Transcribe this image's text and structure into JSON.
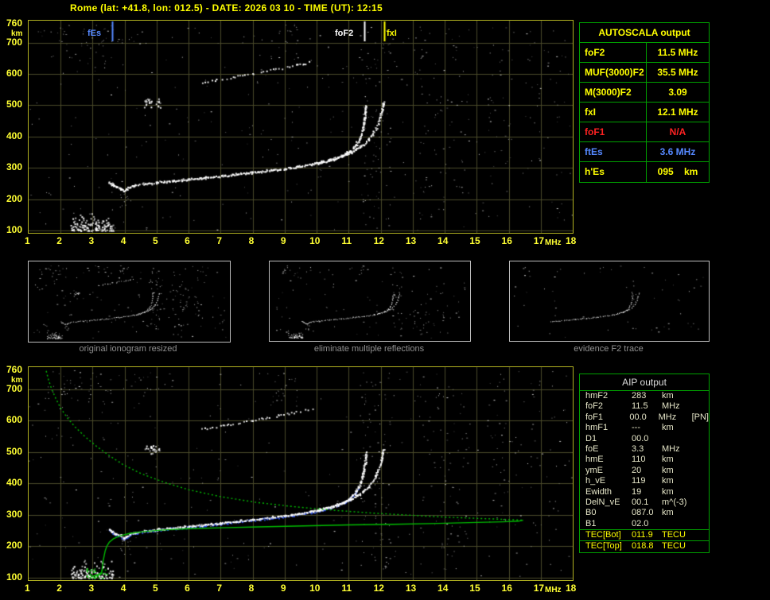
{
  "title": "Rome (lat: +41.8, lon: 012.5) - DATE: 2026 03 10 - TIME (UT): 12:15",
  "colors": {
    "background": "#000000",
    "axis_text": "#ffff33",
    "plot_border": "#b0b020",
    "grid": "#4a4a2a",
    "table_border": "#00a000",
    "yellow": "#ffff00",
    "red": "#ff2222",
    "blue": "#5588ff",
    "profile_green": "#00bb00",
    "trace_white": "#ffffff",
    "trace_blue": "#2f55ff",
    "caption_gray": "#8f8f8f"
  },
  "autoscala": {
    "header": "AUTOSCALA output",
    "rows": [
      {
        "param": "foF2",
        "value": "11.5 MHz"
      },
      {
        "param": "MUF(3000)F2",
        "value": "35.5 MHz"
      },
      {
        "param": "M(3000)F2",
        "value": "3.09"
      },
      {
        "param": "fxI",
        "value": "12.1 MHz"
      },
      {
        "param": "foF1",
        "value": "N/A"
      },
      {
        "param": "ftEs",
        "value": "3.6 MHz"
      },
      {
        "param": "h'Es",
        "value": "095    km"
      }
    ]
  },
  "thumbnails": [
    {
      "caption": "original ionogram resized"
    },
    {
      "caption": "eliminate multiple reflections"
    },
    {
      "caption": "evidence F2 trace"
    }
  ],
  "aip": {
    "header": "AIP output",
    "rows": [
      {
        "param": "hmF2",
        "value": "283",
        "unit": "km",
        "note": ""
      },
      {
        "param": "foF2",
        "value": "11.5",
        "unit": "MHz",
        "note": ""
      },
      {
        "param": "foF1",
        "value": "00.0",
        "unit": "MHz",
        "note": "[PN]"
      },
      {
        "param": "hmF1",
        "value": "---",
        "unit": "km",
        "note": ""
      },
      {
        "param": "D1",
        "value": "00.0",
        "unit": "",
        "note": ""
      },
      {
        "param": "foE",
        "value": "3.3",
        "unit": "MHz",
        "note": ""
      },
      {
        "param": "hmE",
        "value": "110",
        "unit": "km",
        "note": ""
      },
      {
        "param": "ymE",
        "value": "20",
        "unit": "km",
        "note": ""
      },
      {
        "param": "h_vE",
        "value": "119",
        "unit": "km",
        "note": ""
      },
      {
        "param": "Ewidth",
        "value": "19",
        "unit": "km",
        "note": ""
      },
      {
        "param": "DelN_vE",
        "value": "00.1",
        "unit": "m^(-3)",
        "note": ""
      },
      {
        "param": "B0",
        "value": "087.0",
        "unit": "km",
        "note": ""
      },
      {
        "param": "B1",
        "value": "02.0",
        "unit": "",
        "note": ""
      }
    ],
    "tec_rows": [
      {
        "param": "TEC[Bot]",
        "value": "011.9",
        "unit": "TECU"
      },
      {
        "param": "TEC[Top]",
        "value": "018.8",
        "unit": "TECU"
      }
    ]
  },
  "chart_data": {
    "type": "scatter",
    "x_axis": {
      "label": "MHz",
      "range": [
        1,
        18
      ],
      "ticks": [
        1,
        2,
        3,
        4,
        5,
        6,
        7,
        8,
        9,
        10,
        11,
        12,
        13,
        14,
        15,
        16,
        17,
        18
      ]
    },
    "y_axis": {
      "label": "km",
      "range": [
        100,
        760
      ],
      "ticks": [
        760,
        700,
        600,
        500,
        400,
        300,
        200,
        100
      ]
    },
    "markers": [
      {
        "label": "fEs",
        "f": 3.6,
        "color": "#5588ff"
      },
      {
        "label": "foF2",
        "f": 11.5,
        "color": "#ffffff"
      },
      {
        "label": "fxI",
        "f": 12.1,
        "color": "#ffff00"
      }
    ],
    "traces": {
      "o_trace": [
        [
          3.5,
          256
        ],
        [
          3.6,
          248
        ],
        [
          3.72,
          241
        ],
        [
          3.85,
          235
        ],
        [
          3.98,
          229
        ],
        [
          4.05,
          233
        ],
        [
          4.15,
          240
        ],
        [
          4.3,
          245
        ],
        [
          4.6,
          250
        ],
        [
          5.0,
          255
        ],
        [
          5.5,
          260
        ],
        [
          6.0,
          265
        ],
        [
          6.5,
          270
        ],
        [
          7.0,
          275
        ],
        [
          7.5,
          281
        ],
        [
          8.0,
          287
        ],
        [
          8.5,
          293
        ],
        [
          9.0,
          299
        ],
        [
          9.4,
          305
        ],
        [
          9.8,
          312
        ],
        [
          10.1,
          318
        ],
        [
          10.4,
          326
        ],
        [
          10.65,
          334
        ],
        [
          10.85,
          343
        ],
        [
          11.0,
          353
        ],
        [
          11.12,
          364
        ],
        [
          11.22,
          377
        ],
        [
          11.3,
          391
        ],
        [
          11.37,
          407
        ],
        [
          11.42,
          424
        ],
        [
          11.46,
          443
        ],
        [
          11.49,
          463
        ],
        [
          11.51,
          482
        ],
        [
          11.52,
          500
        ]
      ],
      "x_trace": [
        [
          9.9,
          316
        ],
        [
          10.2,
          322
        ],
        [
          10.5,
          330
        ],
        [
          10.8,
          340
        ],
        [
          11.05,
          350
        ],
        [
          11.25,
          362
        ],
        [
          11.45,
          376
        ],
        [
          11.6,
          391
        ],
        [
          11.73,
          408
        ],
        [
          11.83,
          426
        ],
        [
          11.91,
          445
        ],
        [
          11.97,
          464
        ],
        [
          12.02,
          483
        ],
        [
          12.06,
          502
        ],
        [
          12.08,
          512
        ]
      ],
      "second_hop": [
        [
          6.4,
          574
        ],
        [
          6.8,
          581
        ],
        [
          7.2,
          588
        ],
        [
          7.6,
          596
        ],
        [
          8.0,
          603
        ],
        [
          8.4,
          610
        ],
        [
          8.8,
          618
        ],
        [
          9.2,
          626
        ],
        [
          9.55,
          633
        ],
        [
          9.85,
          641
        ]
      ],
      "profile": [
        [
          1.55,
          758
        ],
        [
          1.62,
          730
        ],
        [
          1.72,
          700
        ],
        [
          1.85,
          670
        ],
        [
          2.0,
          640
        ],
        [
          2.2,
          610
        ],
        [
          2.45,
          580
        ],
        [
          2.75,
          550
        ],
        [
          3.1,
          520
        ],
        [
          3.5,
          490
        ],
        [
          3.95,
          460
        ],
        [
          4.5,
          432
        ],
        [
          5.2,
          405
        ],
        [
          6.0,
          380
        ],
        [
          7.0,
          358
        ],
        [
          8.1,
          340
        ],
        [
          9.3,
          326
        ],
        [
          10.5,
          315
        ],
        [
          11.7,
          306
        ],
        [
          12.9,
          299
        ],
        [
          14.0,
          293
        ],
        [
          15.0,
          289
        ],
        [
          15.8,
          286
        ],
        [
          16.3,
          284
        ],
        [
          16.45,
          283
        ],
        [
          16.3,
          280
        ],
        [
          15.8,
          278
        ],
        [
          15.0,
          276
        ],
        [
          13.8,
          273
        ],
        [
          12.4,
          270
        ],
        [
          11.0,
          268
        ],
        [
          9.6,
          265
        ],
        [
          8.2,
          262
        ],
        [
          7.0,
          259
        ],
        [
          6.0,
          256
        ],
        [
          5.2,
          252
        ],
        [
          4.6,
          247
        ],
        [
          4.15,
          241
        ],
        [
          3.85,
          233
        ],
        [
          3.65,
          224
        ],
        [
          3.52,
          213
        ],
        [
          3.44,
          200
        ],
        [
          3.39,
          185
        ],
        [
          3.36,
          170
        ],
        [
          3.33,
          155
        ],
        [
          3.31,
          140
        ],
        [
          3.3,
          128
        ],
        [
          3.28,
          118
        ],
        [
          3.22,
          112
        ],
        [
          3.1,
          107
        ],
        [
          2.95,
          104
        ]
      ]
    },
    "clusters": {
      "es": {
        "f": [
          2.3,
          3.65
        ],
        "k": [
          100,
          162
        ],
        "n": 130,
        "bias": true
      },
      "under_hook": {
        "f": [
          3.85,
          4.2
        ],
        "k": [
          175,
          228
        ],
        "n": 14
      },
      "f_second": {
        "f": [
          4.6,
          5.15
        ],
        "k": [
          494,
          522
        ],
        "n": 26
      },
      "es_green": {
        "f": [
          2.8,
          3.45
        ],
        "k": [
          100,
          132
        ],
        "n": 30
      }
    },
    "noise_bands": [
      {
        "f": [
          11.35,
          12.3
        ],
        "k": [
          110,
          755
        ],
        "n": 85
      },
      {
        "f": [
          13.2,
          14.75
        ],
        "k": [
          110,
          755
        ],
        "n": 65
      },
      {
        "f": [
          15.3,
          16.05
        ],
        "k": [
          250,
          750
        ],
        "n": 30
      },
      {
        "f": [
          1.6,
          3.7
        ],
        "k": [
          620,
          760
        ],
        "n": 38
      },
      {
        "f": [
          8.5,
          9.4
        ],
        "k": [
          640,
          760
        ],
        "n": 24
      },
      {
        "f": [
          16.6,
          17.9
        ],
        "k": [
          120,
          750
        ],
        "n": 20
      },
      {
        "f": [
          1.2,
          8.0
        ],
        "k": [
          690,
          760
        ],
        "n": 26
      }
    ],
    "uniform_noise_count": 300
  }
}
